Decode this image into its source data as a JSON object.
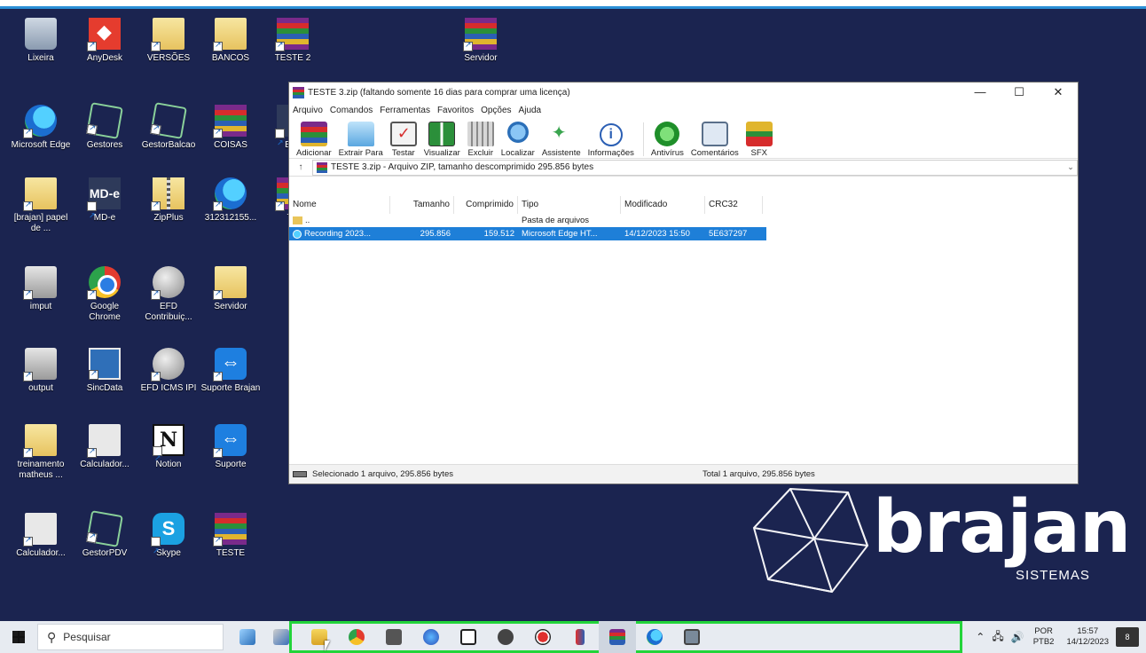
{
  "desktop": {
    "icons": [
      {
        "label": "Lixeira",
        "icon": "recycle-bin-icon"
      },
      {
        "label": "AnyDesk",
        "icon": "anydesk-icon"
      },
      {
        "label": "VERSÕES",
        "icon": "folder-icon"
      },
      {
        "label": "BANCOS",
        "icon": "folder-icon"
      },
      {
        "label": "TESTE 2",
        "icon": "winrar-icon"
      },
      {
        "label": "Servidor",
        "icon": "winrar-icon"
      },
      {
        "label": "Microsoft Edge",
        "icon": "edge-icon"
      },
      {
        "label": "Gestores",
        "icon": "network-icon"
      },
      {
        "label": "GestorBalcao",
        "icon": "network-icon"
      },
      {
        "label": "COISAS",
        "icon": "winrar-icon"
      },
      {
        "label": "Ban",
        "icon": "app-icon"
      },
      {
        "label": "[brajan] papel de ...",
        "icon": "file-icon"
      },
      {
        "label": "MD-e",
        "icon": "mde-icon"
      },
      {
        "label": "ZipPlus",
        "icon": "zip-icon"
      },
      {
        "label": "312312155...",
        "icon": "edge-icon"
      },
      {
        "label": "TE",
        "icon": "winrar-icon"
      },
      {
        "label": "imput",
        "icon": "drive-icon"
      },
      {
        "label": "Google Chrome",
        "icon": "chrome-icon"
      },
      {
        "label": "EFD Contribuiç...",
        "icon": "globe-icon"
      },
      {
        "label": "Servidor",
        "icon": "folder-icon"
      },
      {
        "label": "output",
        "icon": "drive-icon"
      },
      {
        "label": "SincData",
        "icon": "sync-icon"
      },
      {
        "label": "EFD ICMS IPI",
        "icon": "globe-icon"
      },
      {
        "label": "Suporte Brajan",
        "icon": "teamviewer-icon"
      },
      {
        "label": "treinamento matheus ...",
        "icon": "folder-icon"
      },
      {
        "label": "Calculador...",
        "icon": "calculator-icon"
      },
      {
        "label": "Notion",
        "icon": "notion-icon"
      },
      {
        "label": "Suporte",
        "icon": "teamviewer-icon"
      },
      {
        "label": "Calculador...",
        "icon": "calculator-icon"
      },
      {
        "label": "GestorPDV",
        "icon": "network-icon"
      },
      {
        "label": "Skype",
        "icon": "skype-icon"
      },
      {
        "label": "TESTE",
        "icon": "winrar-icon"
      }
    ]
  },
  "window": {
    "title": "TESTE 3.zip (faltando somente 16 dias para comprar uma licença)",
    "controls": {
      "minimize": "—",
      "maximize": "☐",
      "close": "✕"
    },
    "menu": [
      "Arquivo",
      "Comandos",
      "Ferramentas",
      "Favoritos",
      "Opções",
      "Ajuda"
    ],
    "toolbar": [
      {
        "label": "Adicionar",
        "icon": "add-archive-icon"
      },
      {
        "label": "Extrair Para",
        "icon": "extract-folder-icon"
      },
      {
        "label": "Testar",
        "icon": "test-icon"
      },
      {
        "label": "Visualizar",
        "icon": "view-book-icon"
      },
      {
        "label": "Excluir",
        "icon": "trash-icon"
      },
      {
        "label": "Localizar",
        "icon": "find-magnifier-icon"
      },
      {
        "label": "Assistente",
        "icon": "wizard-wand-icon"
      },
      {
        "label": "Informações",
        "icon": "info-icon"
      },
      {
        "label": "Antivírus",
        "icon": "antivirus-icon"
      },
      {
        "label": "Comentários",
        "icon": "comment-icon"
      },
      {
        "label": "SFX",
        "icon": "sfx-icon"
      }
    ],
    "address": {
      "up": "↑",
      "path": "TESTE 3.zip - Arquivo ZIP, tamanho descomprimido 295.856 bytes"
    },
    "columns": [
      "Nome",
      "Tamanho",
      "Comprimido",
      "Tipo",
      "Modificado",
      "CRC32"
    ],
    "rows": [
      {
        "name": "..",
        "size": "",
        "compressed": "",
        "type": "Pasta de arquivos",
        "modified": "",
        "crc": ""
      },
      {
        "name": "Recording 2023...",
        "size": "295.856",
        "compressed": "159.512",
        "type": "Microsoft Edge HT...",
        "modified": "14/12/2023 15:50",
        "crc": "5E637297"
      }
    ],
    "status": {
      "left": "Selecionado 1 arquivo, 295.856 bytes",
      "right": "Total 1 arquivo, 295.856 bytes"
    }
  },
  "logo": {
    "brand": "brajan",
    "sub": "SISTEMAS"
  },
  "taskbar": {
    "search_placeholder": "Pesquisar",
    "pinned": [
      "file-explorer-icon",
      "chrome-icon",
      "calculator-icon",
      "firefox-icon",
      "notion-icon",
      "settings-icon",
      "record-icon",
      "app-icon",
      "winrar-icon",
      "edge-icon",
      "app-window-icon"
    ],
    "lang_1": "POR",
    "lang_2": "PTB2",
    "time": "15:57",
    "date": "14/12/2023",
    "notifications": "8"
  },
  "colors": {
    "desktop": "#1b2450",
    "selection": "#1e7fd8",
    "highlight_box": "#22d43a"
  }
}
